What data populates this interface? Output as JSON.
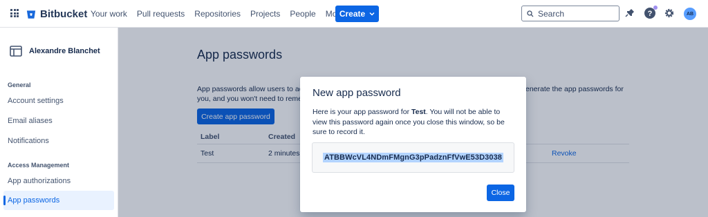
{
  "brand": {
    "name": "Bitbucket",
    "accent": "#0c66e4"
  },
  "topnav": {
    "links": [
      "Your work",
      "Pull requests",
      "Repositories",
      "Projects",
      "People"
    ],
    "more_label": "More",
    "create_label": "Create",
    "search_placeholder": "Search",
    "avatar_initials": "AB"
  },
  "sidebar": {
    "user_name": "Alexandre Blanchet",
    "sections": [
      {
        "title": "General",
        "items": [
          "Account settings",
          "Email aliases",
          "Notifications"
        ]
      },
      {
        "title": "Access Management",
        "items": [
          "App authorizations",
          "App passwords"
        ]
      }
    ],
    "active_item": "App passwords"
  },
  "main": {
    "title": "App passwords",
    "description_line1": "App passwords allow users to ac",
    "description_line2": "you, and you won't need to reme",
    "description_right": "enerate the app passwords for",
    "create_button": "Create app password",
    "table": {
      "headers": [
        "Label",
        "Created"
      ],
      "rows": [
        {
          "label": "Test",
          "created": "2 minutes",
          "action": "Revoke"
        }
      ]
    }
  },
  "modal": {
    "title": "New app password",
    "body_prefix": "Here is your app password for ",
    "body_bold": "Test",
    "body_suffix": ". You will not be able to view this password again once you close this window, so be sure to record it.",
    "password": "ATBBWcVL4NDmFMgnG3pPadznFfVwE53D3038",
    "close_label": "Close"
  }
}
